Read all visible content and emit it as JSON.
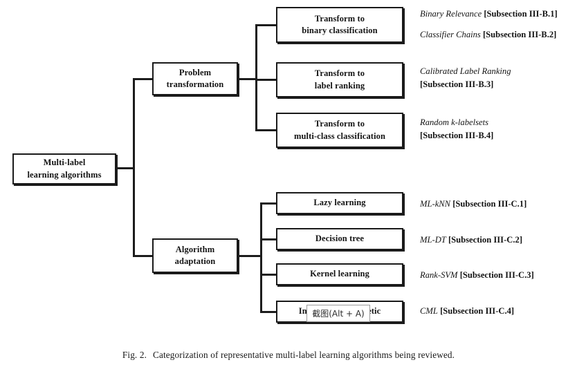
{
  "figure": {
    "caption_number": "Fig. 2.",
    "caption_text": "Categorization of representative multi-label learning algorithms being reviewed."
  },
  "tree": {
    "root": {
      "line1": "Multi-label",
      "line2": "learning algorithms"
    },
    "branches": [
      {
        "id": "problem-transformation",
        "line1": "Problem",
        "line2": "transformation",
        "leaves": [
          {
            "id": "transform-binary-classification",
            "line1": "Transform to",
            "line2": "binary classification",
            "annotations": [
              {
                "algorithm": "Binary Relevance",
                "section": "[Subsection III-B.1]",
                "wrap": false
              },
              {
                "algorithm": "Classifier Chains",
                "section": "[Subsection III-B.2]",
                "wrap": false
              }
            ]
          },
          {
            "id": "transform-label-ranking",
            "line1": "Transform to",
            "line2": "label ranking",
            "annotations": [
              {
                "algorithm": "Calibrated Label Ranking",
                "section": "[Subsection III-B.3]",
                "wrap": true
              }
            ]
          },
          {
            "id": "transform-multiclass-classification",
            "line1": "Transform to",
            "line2": "multi-class classification",
            "annotations": [
              {
                "algorithm": "Random k-labelsets",
                "section": "[Subsection III-B.4]",
                "wrap": true
              }
            ]
          }
        ]
      },
      {
        "id": "algorithm-adaptation",
        "line1": "Algorithm",
        "line2": "adaptation",
        "leaves": [
          {
            "id": "lazy-learning",
            "line1": "Lazy learning",
            "line2": "",
            "annotations": [
              {
                "algorithm": "ML-kNN",
                "section": "[Subsection III-C.1]",
                "wrap": false
              }
            ]
          },
          {
            "id": "decision-tree",
            "line1": "Decision tree",
            "line2": "",
            "annotations": [
              {
                "algorithm": "ML-DT",
                "section": "[Subsection III-C.2]",
                "wrap": false
              }
            ]
          },
          {
            "id": "kernel-learning",
            "line1": "Kernel learning",
            "line2": "",
            "annotations": [
              {
                "algorithm": "Rank-SVM",
                "section": "[Subsection III-C.3]",
                "wrap": false
              }
            ]
          },
          {
            "id": "information-theoretic",
            "line1": "Information-theoretic",
            "line2": "",
            "annotations": [
              {
                "algorithm": "CML",
                "section": "[Subsection III-C.4]",
                "wrap": false
              }
            ]
          }
        ]
      }
    ]
  },
  "overlay": {
    "capture_tooltip": "截图(Alt + A)"
  },
  "colors": {
    "stroke": "#1c1c1c",
    "text": "#141414",
    "background": "#ffffff",
    "tooltip_border": "#9a9a9a"
  }
}
